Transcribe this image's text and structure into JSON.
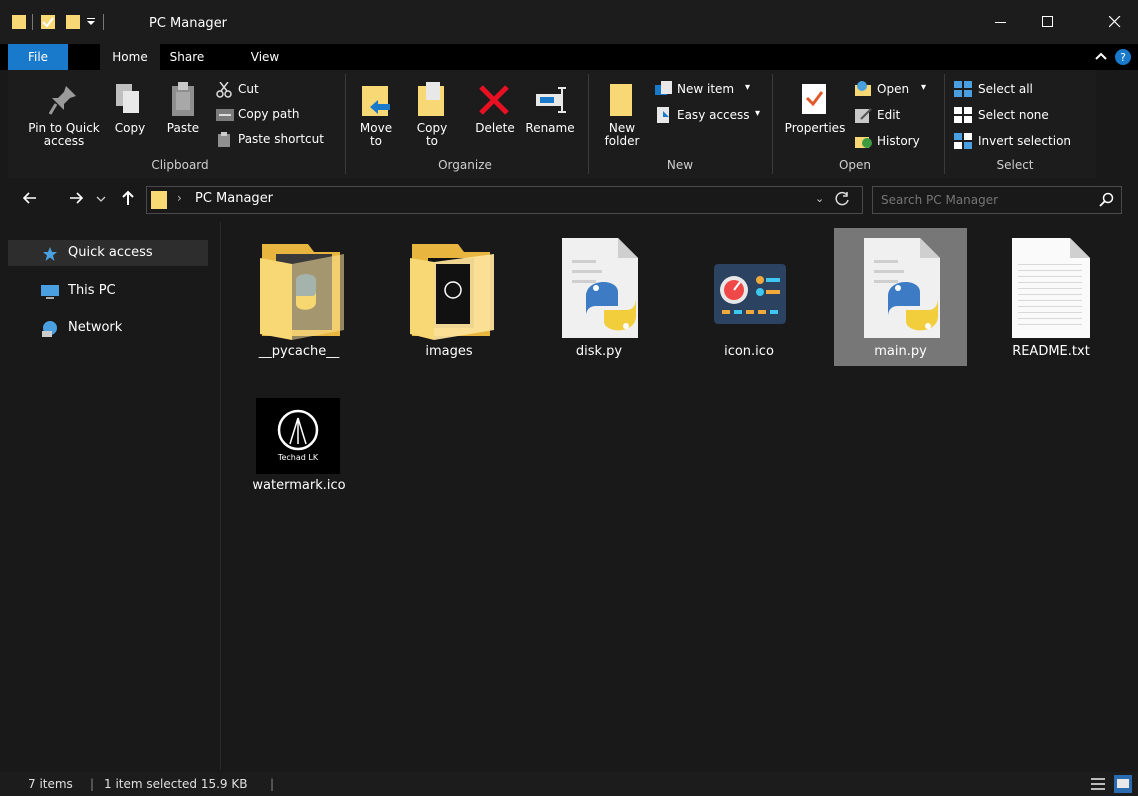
{
  "window": {
    "title": "PC Manager"
  },
  "tabs": [
    "File",
    "Home",
    "Share",
    "View"
  ],
  "ribbon": {
    "clipboard": {
      "pin": "Pin to Quick access",
      "copy": "Copy",
      "paste": "Paste",
      "cut": "Cut",
      "copy_path": "Copy path",
      "paste_shortcut": "Paste shortcut",
      "group": "Clipboard"
    },
    "organize": {
      "move_to": "Move to",
      "copy_to": "Copy to",
      "delete": "Delete",
      "rename": "Rename",
      "group": "Organize"
    },
    "new": {
      "new_folder": "New folder",
      "new_item": "New item",
      "easy_access": "Easy access",
      "group": "New"
    },
    "open": {
      "properties": "Properties",
      "open": "Open",
      "edit": "Edit",
      "history": "History",
      "group": "Open"
    },
    "select": {
      "select_all": "Select all",
      "select_none": "Select none",
      "invert": "Invert selection",
      "group": "Select"
    }
  },
  "address": {
    "path": "PC Manager",
    "search_placeholder": "Search PC Manager"
  },
  "nav": {
    "items": [
      "Quick access",
      "This PC",
      "Network"
    ]
  },
  "files": [
    "__pycache__",
    "images",
    "disk.py",
    "icon.ico",
    "main.py",
    "README.txt",
    "watermark.ico"
  ],
  "selected_file": "main.py",
  "status": {
    "count": "7 items",
    "selected": "1 item selected 15.9 KB"
  },
  "icon_text": {
    "techad_logo": "Techad LK"
  },
  "colors": {
    "accent": "#1979ca",
    "folder": "#f8d775",
    "selection": "#777777"
  }
}
